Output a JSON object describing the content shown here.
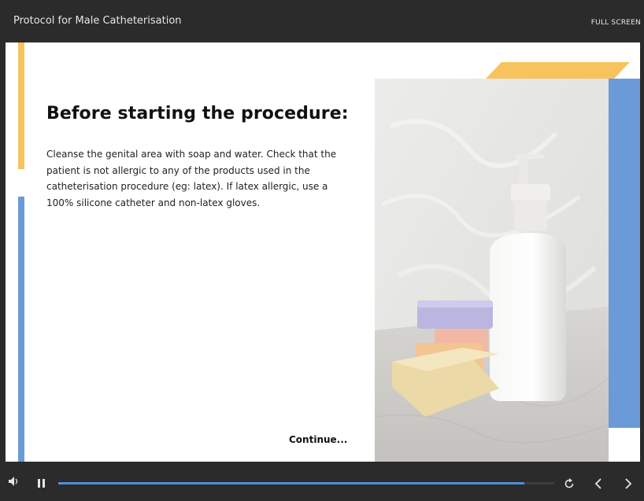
{
  "header": {
    "course_title": "Protocol for Male Catheterisation",
    "fullscreen_label": "FULL SCREEN"
  },
  "slide": {
    "heading": "Before starting the procedure:",
    "body": "Cleanse the genital area with soap and water. Check that the patient is not allergic to any of the products used in the catheterisation procedure (eg: latex). If latex allergic, use a 100% silicone catheter and non-latex gloves.",
    "continue_label": "Continue...",
    "image_subject": "pump-bottle-and-soap-bars"
  },
  "player": {
    "progress_percent": 94,
    "icons": [
      "volume-icon",
      "pause-icon",
      "replay-icon",
      "previous-icon",
      "next-icon"
    ]
  },
  "colors": {
    "accent_yellow": "#f7c35f",
    "accent_blue": "#6a9bd8",
    "progress_blue": "#4f8fd8",
    "chrome": "#2b2b2b"
  }
}
